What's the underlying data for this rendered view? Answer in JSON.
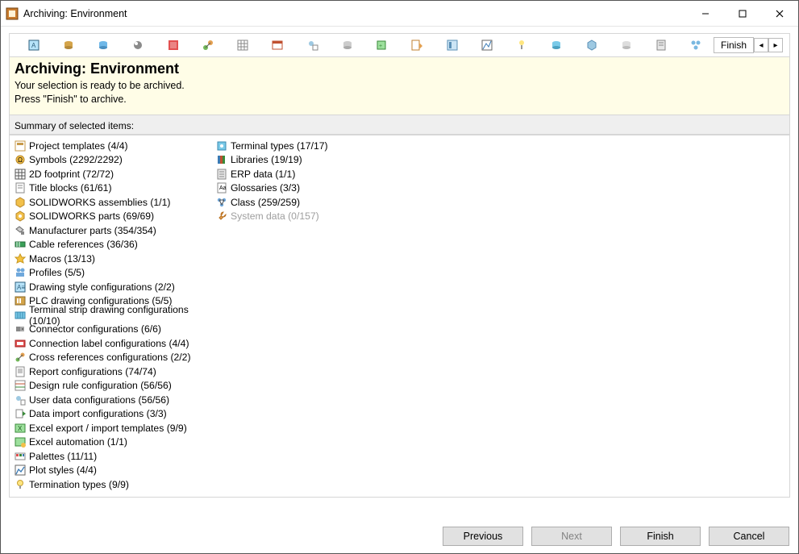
{
  "window": {
    "title": "Archiving: Environment"
  },
  "header": {
    "title": "Archiving: Environment",
    "line1": "Your selection is ready to be archived.",
    "line2": "Press \"Finish\" to archive."
  },
  "toolbar": {
    "finish_tab": "Finish"
  },
  "summary_label": "Summary of selected items:",
  "items_col1": [
    {
      "name": "project-templates",
      "label": "Project templates (4/4)",
      "icon": "template"
    },
    {
      "name": "symbols",
      "label": "Symbols (2292/2292)",
      "icon": "symbol"
    },
    {
      "name": "2d-footprint",
      "label": "2D footprint (72/72)",
      "icon": "grid"
    },
    {
      "name": "title-blocks",
      "label": "Title blocks (61/61)",
      "icon": "doc"
    },
    {
      "name": "solidworks-assemblies",
      "label": "SOLIDWORKS assemblies (1/1)",
      "icon": "sw-asm"
    },
    {
      "name": "solidworks-parts",
      "label": "SOLIDWORKS parts (69/69)",
      "icon": "sw-part"
    },
    {
      "name": "manufacturer-parts",
      "label": "Manufacturer parts (354/354)",
      "icon": "mfr"
    },
    {
      "name": "cable-references",
      "label": "Cable references (36/36)",
      "icon": "cable"
    },
    {
      "name": "macros",
      "label": "Macros (13/13)",
      "icon": "star"
    },
    {
      "name": "profiles",
      "label": "Profiles (5/5)",
      "icon": "profile"
    },
    {
      "name": "drawing-style-cfg",
      "label": "Drawing style configurations (2/2)",
      "icon": "style"
    },
    {
      "name": "plc-drawing-cfg",
      "label": "PLC drawing configurations (5/5)",
      "icon": "plc"
    },
    {
      "name": "terminal-strip-cfg",
      "label": "Terminal strip drawing configurations (10/10)",
      "icon": "terminal-strip"
    },
    {
      "name": "connector-cfg",
      "label": "Connector configurations (6/6)",
      "icon": "connector"
    },
    {
      "name": "connection-label-cfg",
      "label": "Connection label configurations (4/4)",
      "icon": "conn-label"
    },
    {
      "name": "cross-ref-cfg",
      "label": "Cross references configurations (2/2)",
      "icon": "cross-ref"
    },
    {
      "name": "report-cfg",
      "label": "Report configurations (74/74)",
      "icon": "report"
    },
    {
      "name": "design-rule-cfg",
      "label": "Design rule configuration (56/56)",
      "icon": "rule"
    },
    {
      "name": "user-data-cfg",
      "label": "User data configurations (56/56)",
      "icon": "user-data"
    },
    {
      "name": "data-import-cfg",
      "label": "Data import configurations (3/3)",
      "icon": "import"
    },
    {
      "name": "excel-export-import",
      "label": "Excel export / import templates (9/9)",
      "icon": "excel"
    },
    {
      "name": "excel-automation",
      "label": "Excel automation (1/1)",
      "icon": "excel-auto"
    },
    {
      "name": "palettes",
      "label": "Palettes (11/11)",
      "icon": "palette"
    },
    {
      "name": "plot-styles",
      "label": "Plot styles (4/4)",
      "icon": "plot"
    }
  ],
  "items_col2": [
    {
      "name": "termination-types",
      "label": "Termination types (9/9)",
      "icon": "bulb"
    },
    {
      "name": "terminal-types",
      "label": "Terminal types (17/17)",
      "icon": "term"
    },
    {
      "name": "libraries",
      "label": "Libraries (19/19)",
      "icon": "books"
    },
    {
      "name": "erp-data",
      "label": "ERP data (1/1)",
      "icon": "erp"
    },
    {
      "name": "glossaries",
      "label": "Glossaries (3/3)",
      "icon": "glossary"
    },
    {
      "name": "class",
      "label": "Class (259/259)",
      "icon": "class"
    },
    {
      "name": "system-data",
      "label": "System data (0/157)",
      "icon": "wrench",
      "disabled": true
    }
  ],
  "footer": {
    "previous": "Previous",
    "next": "Next",
    "finish": "Finish",
    "cancel": "Cancel"
  }
}
